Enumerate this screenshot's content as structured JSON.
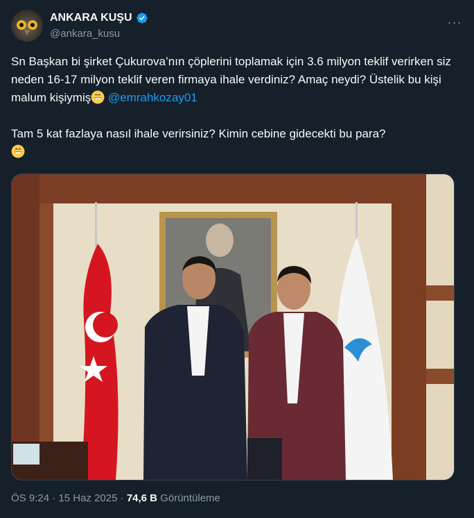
{
  "author": {
    "display_name": "ANKARA KUŞU",
    "handle": "@ankara_kusu",
    "verified": true,
    "avatar_icon": "owl-avatar",
    "more_label": "···"
  },
  "tweet": {
    "line1_text": "Sn Başkan bi şirket Çukurova’nın çöplerini toplamak için 3.6 milyon teklif verirken siz neden 16-17 milyon teklif veren firmaya ihale verdiniz? Amaç neydi? Üstelik bu kişi malum kişiymiş",
    "line1_mention": "@emrahkozay01",
    "line2_text": "Tam 5 kat fazlaya nasıl ihale verirsiniz? Kimin cebine gidecekti bu para?",
    "emoji": "grinning-face"
  },
  "meta": {
    "time": "ÖS 9:24",
    "separator": "·",
    "date": "15 Haz 2025",
    "views_count": "74,6 B",
    "views_label": "Görüntüleme"
  },
  "colors": {
    "background": "#15202b",
    "accent": "#1d9bf0",
    "muted": "#8b98a5",
    "text": "#f7f9f9"
  }
}
